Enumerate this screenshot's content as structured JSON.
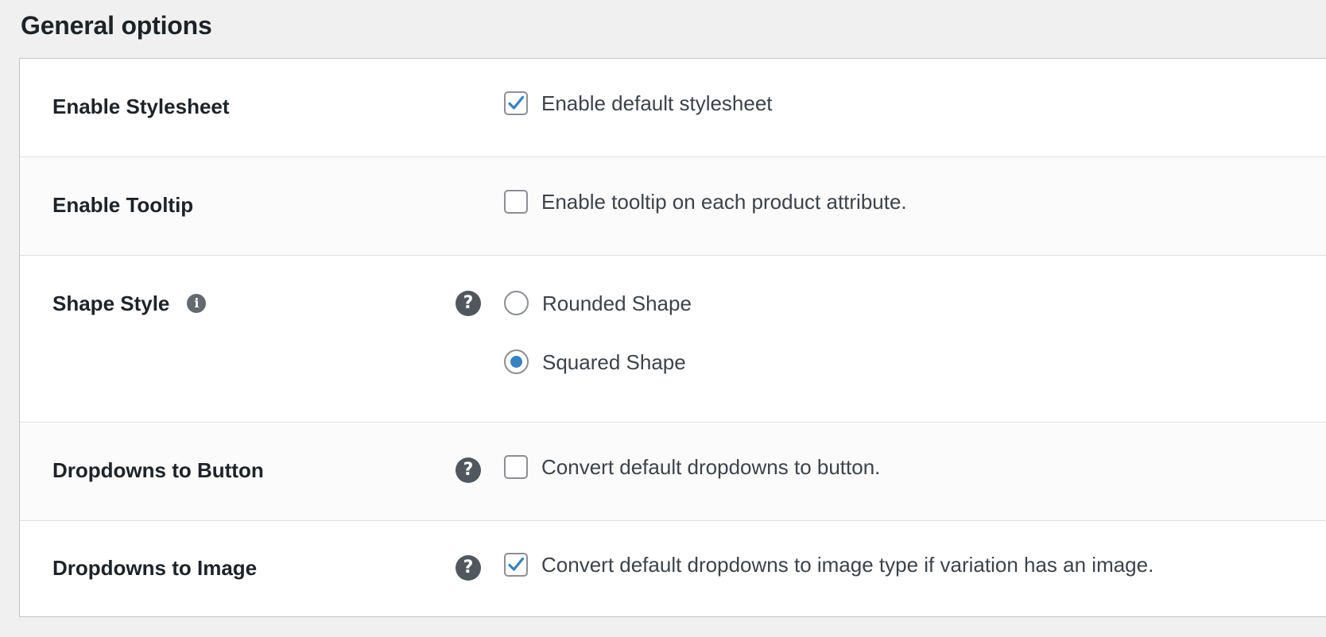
{
  "section": {
    "title": "General options"
  },
  "colors": {
    "accent": "#3582c4",
    "border": "#8c8f94",
    "background": "#f0f0f1"
  },
  "rows": {
    "stylesheet": {
      "label": "Enable Stylesheet",
      "option_text": "Enable default stylesheet",
      "checked": true
    },
    "tooltip": {
      "label": "Enable Tooltip",
      "option_text": "Enable tooltip on each product attribute.",
      "checked": false
    },
    "shape": {
      "label": "Shape Style",
      "info_icon": "info-icon",
      "help_icon": "help-icon",
      "options": [
        {
          "label": "Rounded Shape",
          "selected": false
        },
        {
          "label": "Squared Shape",
          "selected": true
        }
      ]
    },
    "dropdown_button": {
      "label": "Dropdowns to Button",
      "help_icon": "help-icon",
      "option_text": "Convert default dropdowns to button.",
      "checked": false
    },
    "dropdown_image": {
      "label": "Dropdowns to Image",
      "help_icon": "help-icon",
      "option_text": "Convert default dropdowns to image type if variation has an image.",
      "checked": true
    }
  }
}
